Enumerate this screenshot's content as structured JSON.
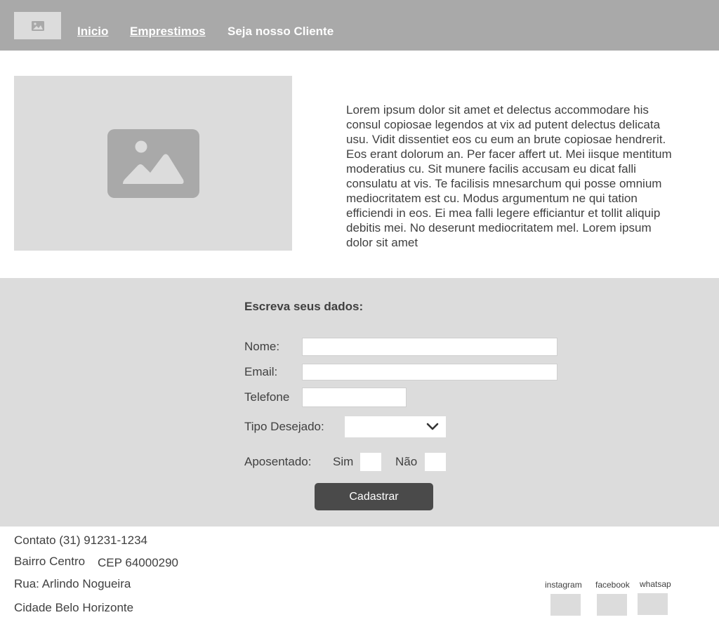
{
  "header": {
    "logo_icon": "image-icon",
    "nav": [
      {
        "label": "Inicio"
      },
      {
        "label": "Emprestimos"
      },
      {
        "label": "Seja nosso Cliente"
      }
    ]
  },
  "hero": {
    "image_icon": "image-icon",
    "text": "Lorem ipsum dolor sit amet et delectus accommodare his consul copiosae legendos at vix ad putent delectus delicata usu. Vidit dissentiet eos cu eum an brute copiosae hendrerit. Eos erant dolorum an. Per facer affert ut. Mei iisque mentitum moderatius cu. Sit munere facilis accusam eu dicat falli consulatu at vis. Te facilisis mnesarchum qui posse omnium mediocritatem est cu. Modus argumentum ne qui tation efficiendi in eos. Ei mea falli legere efficiantur et tollit aliquip debitis mei. No deserunt mediocritatem mel. Lorem ipsum dolor sit amet"
  },
  "form": {
    "title": "Escreva seus dados:",
    "name_label": "Nome:",
    "name_value": "",
    "email_label": "Email:",
    "email_value": "",
    "phone_label": "Telefone",
    "phone_value": "",
    "type_label": "Tipo Desejado:",
    "type_selected": "",
    "retired_label": "Aposentado:",
    "yes_label": "Sim",
    "no_label": "Não",
    "submit_label": "Cadastrar"
  },
  "footer": {
    "contact": "Contato (31) 91231-1234",
    "district": "Bairro Centro",
    "cep": "CEP 64000290",
    "street": "Rua: Arlindo Nogueira",
    "city": "Cidade Belo Horizonte",
    "social": [
      {
        "label": "instagram"
      },
      {
        "label": "facebook"
      },
      {
        "label": "whatsap"
      }
    ]
  },
  "colors": {
    "header_bg": "#a9a9a9",
    "placeholder_bg": "#dcdcdc",
    "button_bg": "#4a4a4a"
  }
}
